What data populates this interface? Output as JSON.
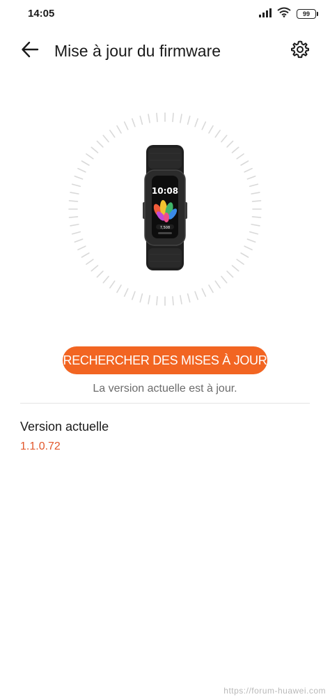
{
  "status_bar": {
    "time": "14:05",
    "battery_level": "99",
    "icons": [
      "signal-icon",
      "wifi-icon",
      "battery-icon"
    ]
  },
  "header": {
    "title": "Mise à jour du firmware",
    "back_icon": "back-arrow-icon",
    "settings_icon": "gear-icon"
  },
  "device": {
    "screen_time": "10:08",
    "screen_badge": "7,508",
    "image": "smart-band"
  },
  "update": {
    "button_label": "RECHERCHER DES MISES À JOUR",
    "status": "La version actuelle est à jour."
  },
  "current_version": {
    "label": "Version actuelle",
    "value": "1.1.0.72"
  },
  "watermark": "https://forum-huawei.com",
  "colors": {
    "accent": "#f26522",
    "version_value": "#e2572b",
    "status_text": "#6b6b6b"
  }
}
